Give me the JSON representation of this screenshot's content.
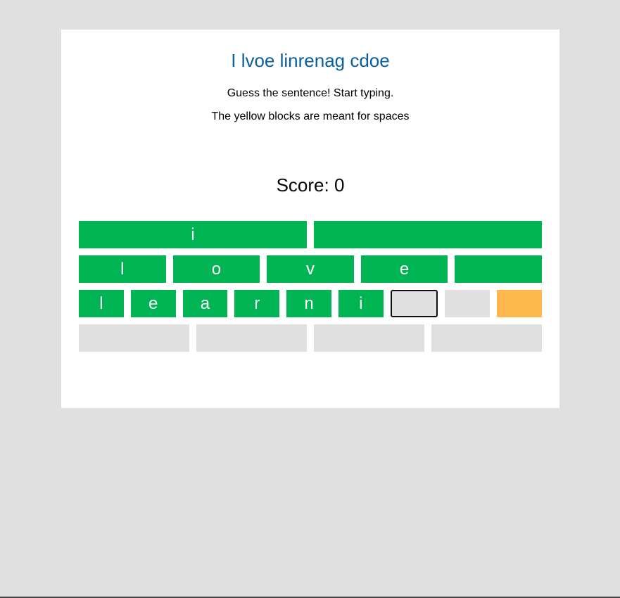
{
  "game": {
    "title": "I lvoe linrenag cdoe",
    "instructions": "Guess the sentence! Start typing.",
    "hint": "The yellow blocks are meant for spaces",
    "score_text": "Score: 0",
    "score": 0
  },
  "colors": {
    "correct": "#00b454",
    "space": "#ffb84d",
    "empty": "#e0e0e0",
    "title": "#0a5fa0"
  },
  "rows": [
    [
      {
        "letter": "i",
        "state": "correct"
      },
      {
        "letter": "",
        "state": "correct"
      }
    ],
    [
      {
        "letter": "l",
        "state": "correct"
      },
      {
        "letter": "o",
        "state": "correct"
      },
      {
        "letter": "v",
        "state": "correct"
      },
      {
        "letter": "e",
        "state": "correct"
      },
      {
        "letter": "",
        "state": "correct"
      }
    ],
    [
      {
        "letter": "l",
        "state": "correct"
      },
      {
        "letter": "e",
        "state": "correct"
      },
      {
        "letter": "a",
        "state": "correct"
      },
      {
        "letter": "r",
        "state": "correct"
      },
      {
        "letter": "n",
        "state": "correct"
      },
      {
        "letter": "i",
        "state": "correct"
      },
      {
        "letter": "",
        "state": "active"
      },
      {
        "letter": "",
        "state": "empty"
      },
      {
        "letter": "",
        "state": "space"
      }
    ],
    [
      {
        "letter": "",
        "state": "empty"
      },
      {
        "letter": "",
        "state": "empty"
      },
      {
        "letter": "",
        "state": "empty"
      },
      {
        "letter": "",
        "state": "empty"
      }
    ]
  ]
}
